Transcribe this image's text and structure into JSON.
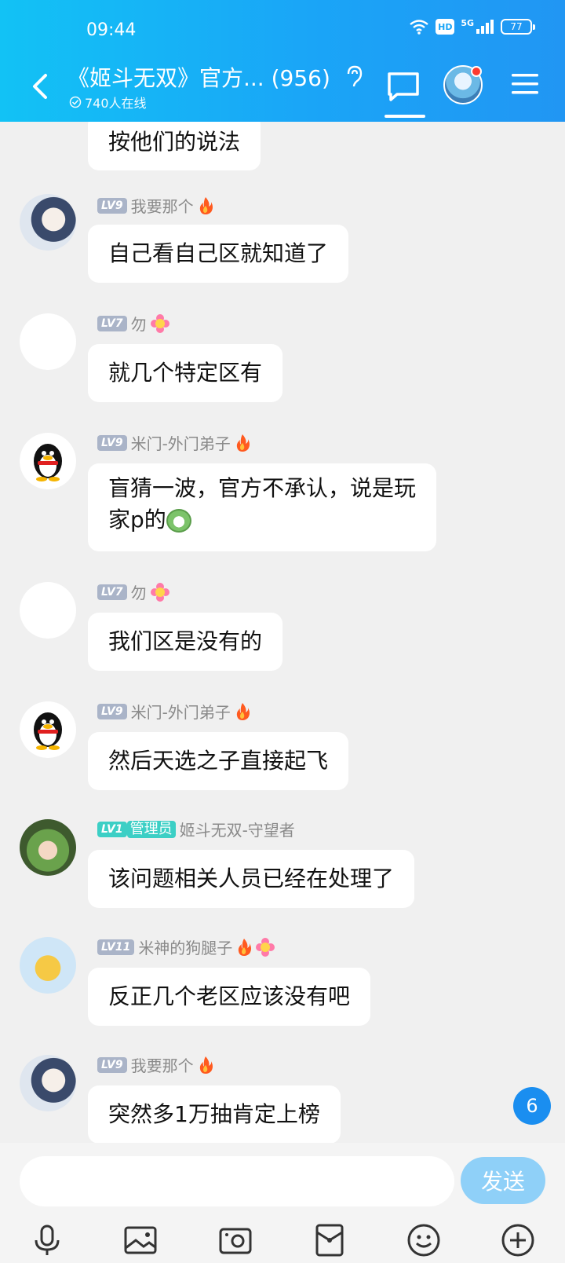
{
  "status_bar": {
    "time": "09:44",
    "hd": "HD",
    "network": "5G",
    "battery": "77"
  },
  "header": {
    "title": "《姬斗无双》官方...  (956)",
    "online": "740人在线"
  },
  "unread_count": "6",
  "composer": {
    "placeholder": "",
    "send_label": "发送"
  },
  "messages": [
    {
      "level": "",
      "name": "",
      "text": "按他们的说法"
    },
    {
      "level": "LV9",
      "name": "我要那个",
      "text": "自己看自己区就知道了"
    },
    {
      "level": "LV7",
      "name": "勿",
      "text": "就几个特定区有"
    },
    {
      "level": "LV9",
      "name": "米门-外门弟子",
      "text_line1": "盲猜一波，官方不承认，说是玩",
      "text_line2": "家p的"
    },
    {
      "level": "LV7",
      "name": "勿",
      "text": "我们区是没有的"
    },
    {
      "level": "LV9",
      "name": "米门-外门弟子",
      "text": "然后天选之子直接起飞"
    },
    {
      "level": "LV1",
      "role": "管理员",
      "name": "姬斗无双-守望者",
      "text": "该问题相关人员已经在处理了"
    },
    {
      "level": "LV11",
      "name": "米神的狗腿子",
      "text": "反正几个老区应该没有吧"
    },
    {
      "level": "LV9",
      "name": "我要那个",
      "text": "突然多1万抽肯定上榜"
    }
  ],
  "icons": {
    "toolbar": [
      "microphone-icon",
      "image-icon",
      "camera-icon",
      "red-packet-icon",
      "emoji-icon",
      "plus-icon"
    ]
  }
}
